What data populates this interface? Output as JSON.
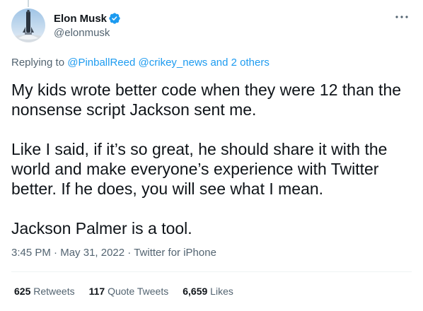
{
  "author": {
    "display_name": "Elon Musk",
    "handle": "@elonmusk",
    "avatar_icon": "rocket-launch-avatar-icon",
    "verified_icon": "verified-badge-icon"
  },
  "header": {
    "more_icon": "more-options-icon"
  },
  "replying": {
    "prefix": "Replying to ",
    "mention1": "@PinballReed",
    "mention2": "@crikey_news",
    "suffix": "and 2 others"
  },
  "tweet": {
    "paragraphs": [
      "My kids wrote better code when they were 12 than the nonsense script Jackson sent me.",
      "Like I said, if it’s so great, he should share it with the world and make everyone’s experience with Twitter better. If he does, you will see what I mean.",
      "Jackson Palmer is a tool."
    ]
  },
  "meta": {
    "time": "3:45 PM",
    "date": "May 31, 2022",
    "source": "Twitter for iPhone",
    "separator": " · "
  },
  "stats": {
    "retweets_count": "625",
    "retweets_label": "Retweets",
    "quotes_count": "117",
    "quotes_label": "Quote Tweets",
    "likes_count": "6,659",
    "likes_label": "Likes"
  },
  "colors": {
    "link": "#1d9bf0",
    "secondary_text": "#536471",
    "primary_text": "#0f1419",
    "divider": "#eff3f4"
  }
}
